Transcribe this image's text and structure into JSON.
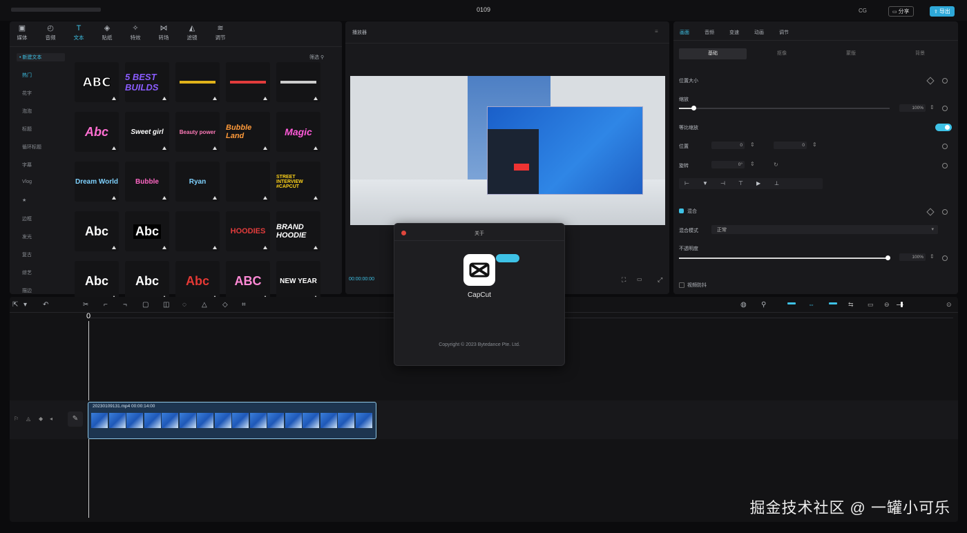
{
  "window": {
    "title": "0109",
    "share_label": "分享",
    "export_label": "导出",
    "layout_label": "CG"
  },
  "media_toolbar": [
    {
      "label": "媒体",
      "icon": "media-icon"
    },
    {
      "label": "音频",
      "icon": "audio-icon"
    },
    {
      "label": "文本",
      "icon": "text-icon"
    },
    {
      "label": "贴纸",
      "icon": "sticker-icon"
    },
    {
      "label": "特效",
      "icon": "effects-icon"
    },
    {
      "label": "转场",
      "icon": "transition-icon"
    },
    {
      "label": "滤镜",
      "icon": "filter-icon"
    },
    {
      "label": "调节",
      "icon": "adjust-icon"
    }
  ],
  "text_sidebar": {
    "header": "• 新建文本",
    "items": [
      "热门",
      "花字",
      "泡泡",
      "标题",
      "循环标题",
      "字幕",
      "Vlog",
      "★",
      "边框",
      "发光",
      "复古",
      "综艺",
      "描边"
    ]
  },
  "template_filter": "筛选",
  "templates": [
    "ABC",
    "5 BEST BUILDS",
    "",
    "",
    "",
    "Abc",
    "Sweet girl",
    "Beauty power",
    "Bubble Land",
    "Magic",
    "Dream World",
    "Bubble",
    "Ryan",
    "",
    "STREET INTERVIEW #CAPCUT",
    "Abc",
    "Abc",
    "",
    "HOODIES",
    "BRAND HOODIE",
    "Abc",
    "Abc",
    "Abc",
    "ABC",
    "NEW YEAR"
  ],
  "player": {
    "title": "播放器",
    "timecode": "00:00:00:00"
  },
  "about_dialog": {
    "title": "关于",
    "app_name": "CapCut",
    "badge": "",
    "copyright": "Copyright © 2023 Bytedance Pte. Ltd."
  },
  "inspector": {
    "top_tabs": [
      "画面",
      "音频",
      "变速",
      "动画",
      "调节"
    ],
    "sub_tabs": [
      "基础",
      "抠像",
      "蒙版",
      "背景"
    ],
    "section_position_size": "位置大小",
    "scale_label": "缩放",
    "scale_value": "100%",
    "uniform_scale_label": "等比缩放",
    "position_label": "位置",
    "pos_x": "0",
    "pos_y": "0",
    "rotate_label": "旋转",
    "rotate_value": "0°",
    "section_blend": "混合",
    "blend_mode_label": "混合模式",
    "blend_mode_value": "正常",
    "opacity_label": "不透明度",
    "opacity_value": "100%",
    "section_stabilize": "视频防抖",
    "scale_level": 0.1,
    "opacity_level": 1.0
  },
  "timeline": {
    "cursor_label": "0",
    "clip_name": "20230109131.mp4  00:00:14:00",
    "watermark": "掘金技术社区 @ 一罐小可乐"
  },
  "colors": {
    "accent": "#3ec2e6",
    "background": "#0b0b0d",
    "panel": "#19191c"
  }
}
